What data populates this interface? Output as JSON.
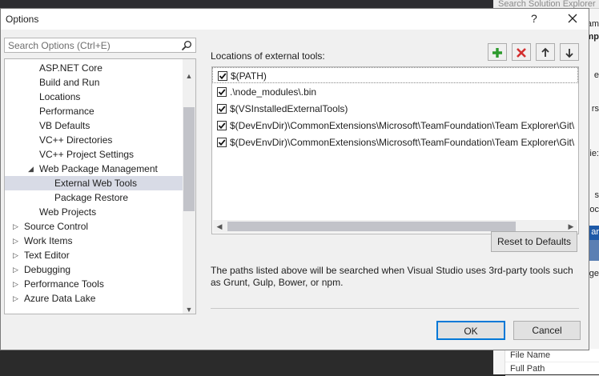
{
  "background": {
    "search_strip": "Search Solution Explorer",
    "fragments": [
      "am",
      "mp",
      "e",
      "rs",
      "ie:",
      "s",
      "ioc",
      "ge",
      "ar"
    ],
    "properties": [
      "File Name",
      "Full Path"
    ]
  },
  "dialog": {
    "title": "Options",
    "help_label": "?",
    "search": {
      "placeholder": "Search Options (Ctrl+E)",
      "value": ""
    },
    "tree": [
      {
        "label": "ASP.NET Core",
        "level": 2,
        "arrow": ""
      },
      {
        "label": "Build and Run",
        "level": 2,
        "arrow": ""
      },
      {
        "label": "Locations",
        "level": 2,
        "arrow": ""
      },
      {
        "label": "Performance",
        "level": 2,
        "arrow": ""
      },
      {
        "label": "VB Defaults",
        "level": 2,
        "arrow": ""
      },
      {
        "label": "VC++ Directories",
        "level": 2,
        "arrow": ""
      },
      {
        "label": "VC++ Project Settings",
        "level": 2,
        "arrow": ""
      },
      {
        "label": "Web Package Management",
        "level": 2,
        "arrow": "expanded"
      },
      {
        "label": "External Web Tools",
        "level": 3,
        "arrow": "",
        "selected": true
      },
      {
        "label": "Package Restore",
        "level": 3,
        "arrow": ""
      },
      {
        "label": "Web Projects",
        "level": 2,
        "arrow": ""
      },
      {
        "label": "Source Control",
        "level": 1,
        "arrow": "collapsed"
      },
      {
        "label": "Work Items",
        "level": 1,
        "arrow": "collapsed"
      },
      {
        "label": "Text Editor",
        "level": 1,
        "arrow": "collapsed"
      },
      {
        "label": "Debugging",
        "level": 1,
        "arrow": "collapsed"
      },
      {
        "label": "Performance Tools",
        "level": 1,
        "arrow": "collapsed"
      },
      {
        "label": "Azure Data Lake",
        "level": 1,
        "arrow": "collapsed"
      }
    ],
    "locations_label": "Locations of external tools:",
    "toolbar": {
      "add_icon": "plus-icon",
      "remove_icon": "x-icon",
      "up_icon": "arrow-up-icon",
      "down_icon": "arrow-down-icon",
      "add_color": "#2e9b2e",
      "remove_color": "#d32f2f"
    },
    "paths": [
      {
        "text": "$(PATH)",
        "checked": true
      },
      {
        "text": ".\\node_modules\\.bin",
        "checked": true
      },
      {
        "text": "$(VSInstalledExternalTools)",
        "checked": true
      },
      {
        "text": "$(DevEnvDir)\\CommonExtensions\\Microsoft\\TeamFoundation\\Team Explorer\\Git\\",
        "checked": true
      },
      {
        "text": "$(DevEnvDir)\\CommonExtensions\\Microsoft\\TeamFoundation\\Team Explorer\\Git\\",
        "checked": true
      }
    ],
    "reset_label": "Reset to Defaults",
    "description": "The paths listed above will be searched when Visual Studio uses 3rd-party tools such as Grunt, Gulp, Bower, or npm.",
    "ok_label": "OK",
    "cancel_label": "Cancel"
  }
}
